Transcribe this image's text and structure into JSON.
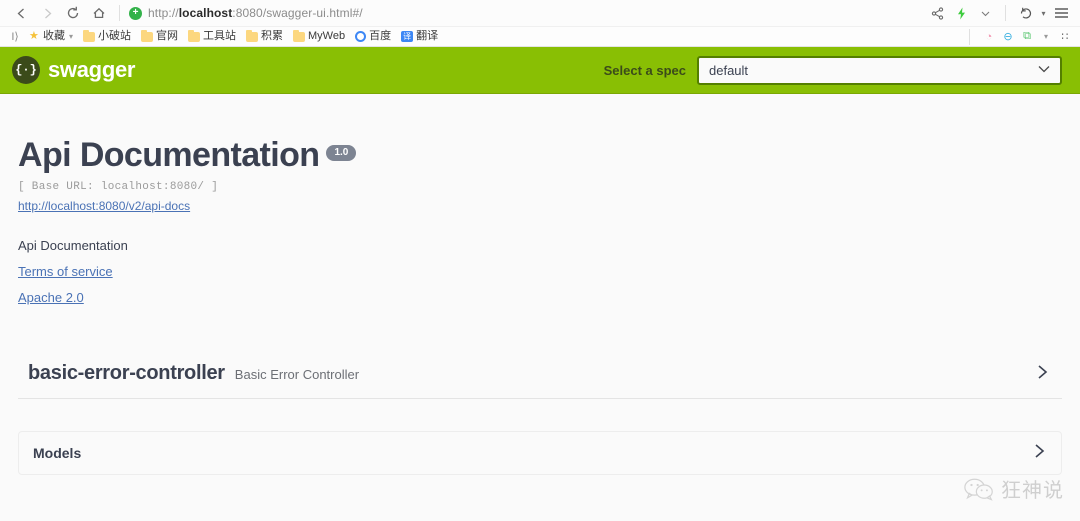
{
  "browser": {
    "nav": {
      "back": "back-arrow",
      "forward": "forward-arrow",
      "reload": "reload-icon",
      "home": "home-icon"
    },
    "address": {
      "secure_glyph": "+",
      "url_prefix": "http://",
      "url_host": "localhost",
      "url_suffix": ":8080/swagger-ui.html#/",
      "full_url": "http://localhost:8080/swagger-ui.html#/"
    },
    "toolbar_right": [
      {
        "name": "share-icon",
        "glyph": "≪"
      },
      {
        "name": "download-icon",
        "glyph": "⚡"
      },
      {
        "name": "chevron-down-icon",
        "glyph": "∨"
      },
      {
        "name": "history-back-icon",
        "glyph": "↺"
      },
      {
        "name": "menu-icon",
        "glyph": "≡"
      }
    ],
    "bookmarks": {
      "apps_glyph": "I⟩",
      "items": [
        {
          "label": "收藏",
          "icon": "star-icon",
          "caret": true
        },
        {
          "label": "小破站",
          "icon": "folder-icon",
          "caret": false
        },
        {
          "label": "官网",
          "icon": "folder-icon",
          "caret": false
        },
        {
          "label": "工具站",
          "icon": "folder-icon",
          "caret": false
        },
        {
          "label": "积累",
          "icon": "folder-icon",
          "caret": false
        },
        {
          "label": "MyWeb",
          "icon": "folder-icon",
          "caret": false
        },
        {
          "label": "百度",
          "icon": "baidu-icon",
          "caret": false
        },
        {
          "label": "翻译",
          "icon": "translate-icon",
          "caret": false
        }
      ],
      "right_icons": [
        {
          "name": "cat-extension-icon",
          "glyph": "◔",
          "color": "#f29ab4"
        },
        {
          "name": "adblock-extension-icon",
          "glyph": "⊖",
          "color": "#3ab0e0"
        },
        {
          "name": "add-extension-icon",
          "glyph": "⧉",
          "color": "#52c46a"
        },
        {
          "name": "extension-caret-icon",
          "glyph": "▾",
          "color": "#9a9a9a"
        },
        {
          "name": "grid-apps-icon",
          "glyph": "∷",
          "color": "#5a5a5a"
        }
      ]
    }
  },
  "topbar": {
    "logo_glyph": "{·}",
    "brand": "swagger",
    "spec_label": "Select a spec",
    "spec_value": "default",
    "spec_caret": "⌄",
    "background_color": "#89bf04"
  },
  "main": {
    "title": "Api Documentation",
    "version": "1.0",
    "base_url": "[ Base URL: localhost:8080/ ]",
    "docs_link": "http://localhost:8080/v2/api-docs",
    "description": "Api Documentation",
    "terms_link": "Terms of service",
    "license_link": "Apache 2.0",
    "tags": [
      {
        "name": "basic-error-controller",
        "description": "Basic Error Controller",
        "expand_glyph": "›"
      }
    ],
    "models": {
      "title": "Models",
      "expand_glyph": "›"
    }
  },
  "watermark": {
    "text": "狂神说",
    "icon": "wechat-icon"
  }
}
